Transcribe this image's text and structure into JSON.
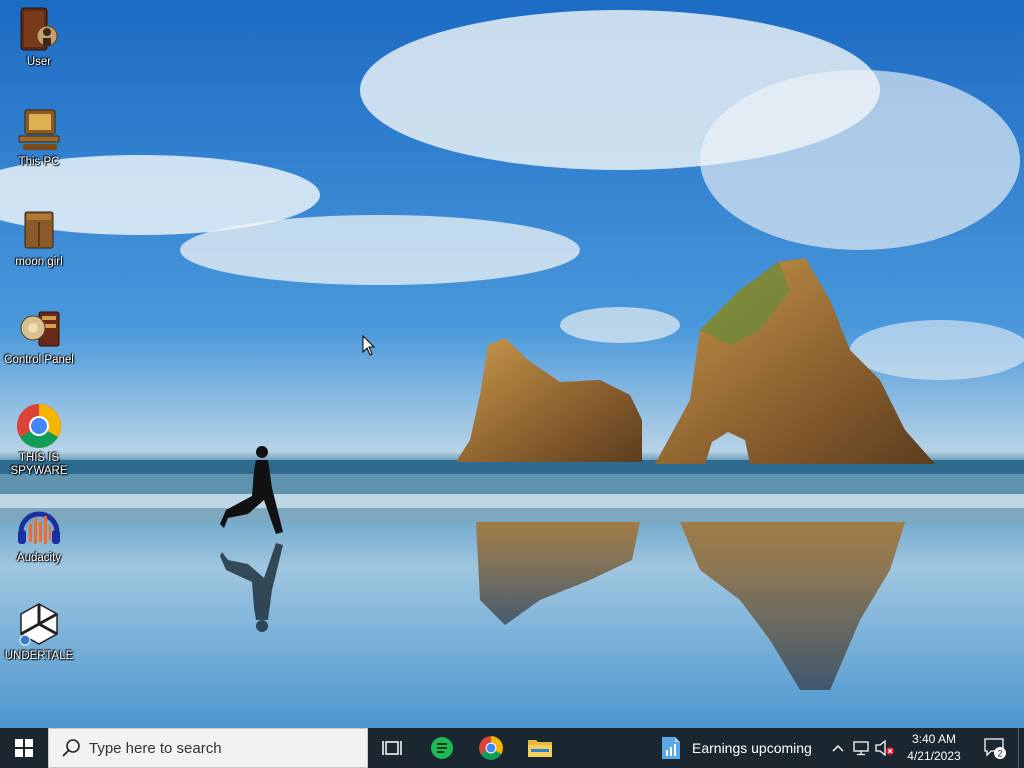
{
  "desktop": {
    "icons": [
      {
        "label": "User",
        "icon": "user-folder-icon"
      },
      {
        "label": "This PC",
        "icon": "computer-icon"
      },
      {
        "label": "moon girl",
        "icon": "box-folder-icon"
      },
      {
        "label": "Control Panel",
        "icon": "control-panel-icon"
      },
      {
        "label": "THIS IS SPYWARE",
        "icon": "chrome-icon"
      },
      {
        "label": "Audacity",
        "icon": "audacity-icon"
      },
      {
        "label": "UNDERTALE",
        "icon": "unity-icon"
      }
    ]
  },
  "taskbar": {
    "search_placeholder": "Type here to search",
    "pinned": [
      "task-view-icon",
      "green-notes-app-icon",
      "chrome-icon",
      "file-explorer-icon"
    ],
    "news_text": "Earnings upcoming",
    "time": "3:40 AM",
    "date": "4/21/2023",
    "notification_count": "2"
  },
  "colors": {
    "taskbar_bg": "#1a2630",
    "search_bg": "#f2f2f2",
    "accent_blue": "#0078d7"
  }
}
